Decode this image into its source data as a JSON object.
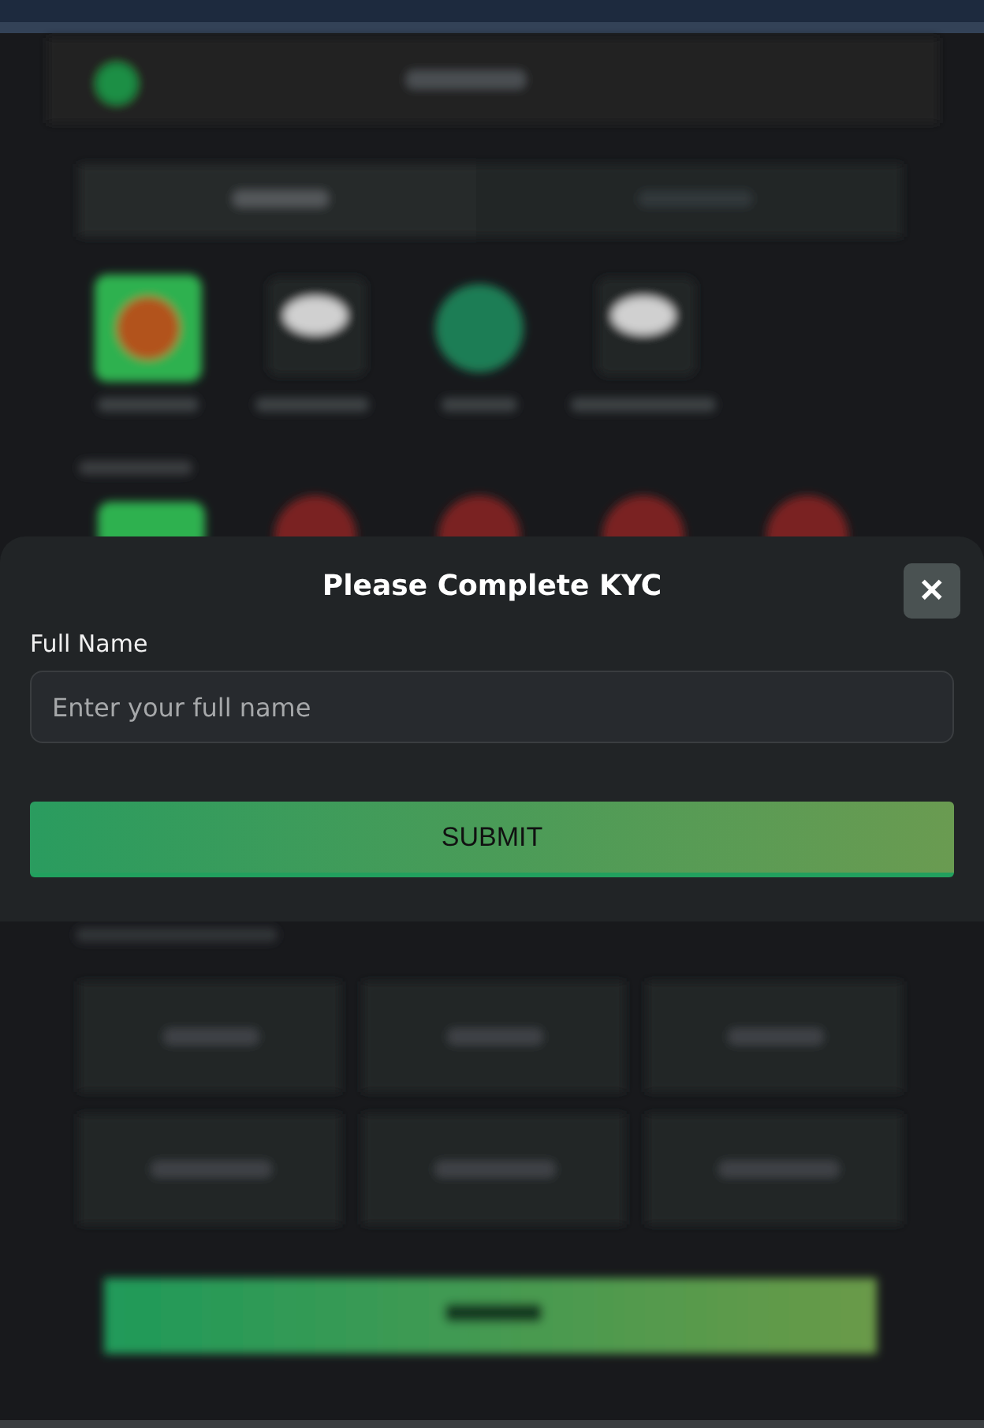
{
  "dialog": {
    "title": "Please Complete KYC",
    "close_label": "✕",
    "field": {
      "label": "Full Name",
      "placeholder": "Enter your full name"
    },
    "submit_label": "SUBMIT"
  }
}
